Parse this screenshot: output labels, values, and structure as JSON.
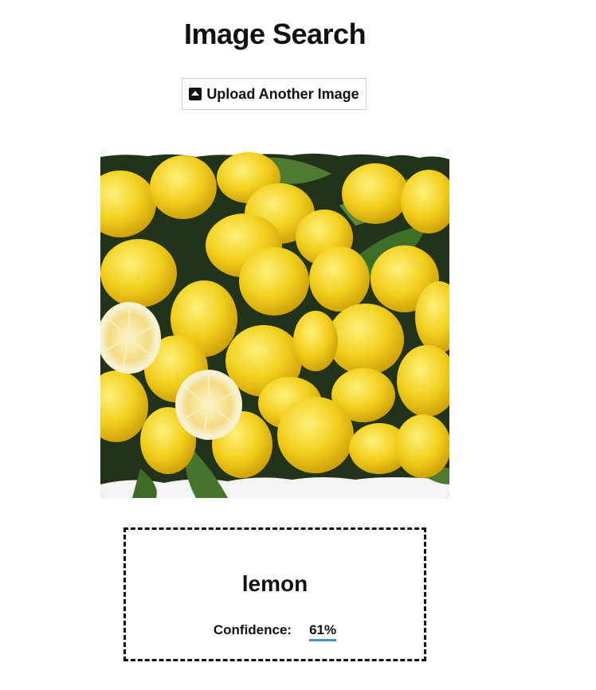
{
  "header": {
    "title": "Image Search"
  },
  "upload": {
    "label": "Upload Another Image",
    "icon": "upload-icon"
  },
  "image": {
    "subject": "lemons",
    "alt": "Pile of lemons with leaves"
  },
  "result": {
    "label": "lemon",
    "confidence_label": "Confidence:",
    "confidence_value": "61%"
  },
  "colors": {
    "accent": "#4a90c8",
    "lemon": "#f2cf1d"
  }
}
